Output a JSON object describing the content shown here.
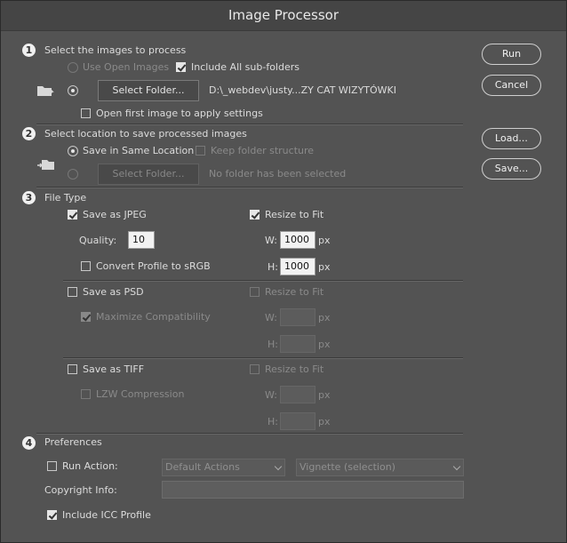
{
  "window": {
    "title": "Image Processor"
  },
  "section1": {
    "number": "1",
    "heading": "Select the images to process",
    "use_open_images": "Use Open Images",
    "include_subfolders": "Include All sub-folders",
    "select_folder": "Select Folder...",
    "folder_path": "D:\\_webdev\\justy...ZY CAT WIZYTÓWKI",
    "open_first_image": "Open first image to apply settings"
  },
  "section2": {
    "number": "2",
    "heading": "Select location to save processed images",
    "save_same_location": "Save in Same Location",
    "keep_folder_structure": "Keep folder structure",
    "select_folder": "Select Folder...",
    "no_folder": "No folder has been selected"
  },
  "section3": {
    "number": "3",
    "heading": "File Type",
    "jpeg": {
      "save_label": "Save as JPEG",
      "resize_label": "Resize to Fit",
      "quality_label": "Quality:",
      "quality_value": "10",
      "convert_label": "Convert Profile to sRGB",
      "w_label": "W:",
      "w_value": "1000",
      "h_label": "H:",
      "h_value": "1000",
      "unit": "px"
    },
    "psd": {
      "save_label": "Save as PSD",
      "resize_label": "Resize to Fit",
      "maximize_label": "Maximize Compatibility",
      "w_label": "W:",
      "h_label": "H:",
      "unit": "px"
    },
    "tiff": {
      "save_label": "Save as TIFF",
      "resize_label": "Resize to Fit",
      "lzw_label": "LZW Compression",
      "w_label": "W:",
      "h_label": "H:",
      "unit": "px"
    }
  },
  "section4": {
    "number": "4",
    "heading": "Preferences",
    "run_action_label": "Run Action:",
    "action_set": "Default Actions",
    "action": "Vignette (selection)",
    "copyright_label": "Copyright Info:",
    "copyright_value": "",
    "icc_label": "Include ICC Profile"
  },
  "buttons": {
    "run": "Run",
    "cancel": "Cancel",
    "load": "Load...",
    "save": "Save..."
  }
}
